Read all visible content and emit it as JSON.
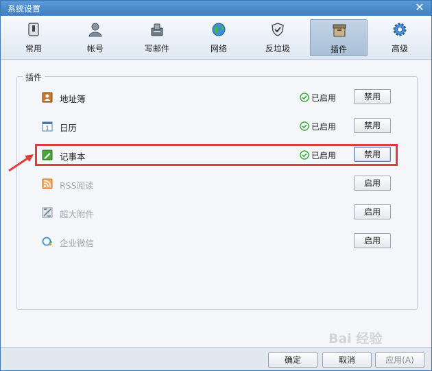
{
  "window": {
    "title": "系统设置"
  },
  "tabs": [
    {
      "label": "常用",
      "icon": "general-icon",
      "active": false
    },
    {
      "label": "帐号",
      "icon": "account-icon",
      "active": false
    },
    {
      "label": "写邮件",
      "icon": "compose-icon",
      "active": false
    },
    {
      "label": "网络",
      "icon": "network-icon",
      "active": false
    },
    {
      "label": "反垃圾",
      "icon": "antispam-shield-icon",
      "active": false
    },
    {
      "label": "插件",
      "icon": "plugin-box-icon",
      "active": true
    },
    {
      "label": "高级",
      "icon": "advanced-gear-icon",
      "active": false
    }
  ],
  "plugins": {
    "group_title": "插件",
    "items": [
      {
        "name": "地址簿",
        "icon": "address-book-icon",
        "status": "已启用",
        "button": "禁用",
        "enabled": true
      },
      {
        "name": "日历",
        "icon": "calendar-icon",
        "status": "已启用",
        "button": "禁用",
        "enabled": true
      },
      {
        "name": "记事本",
        "icon": "notepad-icon",
        "status": "已启用",
        "button": "禁用",
        "enabled": true
      },
      {
        "name": "RSS阅读",
        "icon": "rss-icon",
        "status": "",
        "button": "启用",
        "enabled": false
      },
      {
        "name": "超大附件",
        "icon": "large-attachment-icon",
        "status": "",
        "button": "启用",
        "enabled": false
      },
      {
        "name": "企业微信",
        "icon": "wework-icon",
        "status": "",
        "button": "启用",
        "enabled": false
      }
    ]
  },
  "footer": {
    "ok": "确定",
    "cancel": "取消",
    "apply": "应用(A)"
  },
  "watermark": "Bai 经验",
  "colors": {
    "highlight": "#e13c3c",
    "accent": "#3f7fc1",
    "enabled_check": "#3aa63a"
  }
}
